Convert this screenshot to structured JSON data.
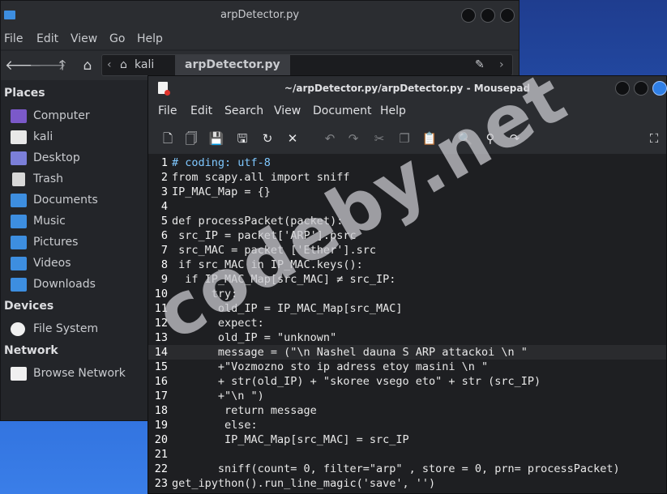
{
  "file_manager": {
    "title": "arpDetector.py",
    "menu": [
      "File",
      "Edit",
      "View",
      "Go",
      "Help"
    ],
    "breadcrumbs": [
      "kali",
      "arpDetector.py"
    ],
    "sidebar": {
      "places_header": "Places",
      "places": [
        "Computer",
        "kali",
        "Desktop",
        "Trash",
        "Documents",
        "Music",
        "Pictures",
        "Videos",
        "Downloads"
      ],
      "devices_header": "Devices",
      "devices": [
        "File System"
      ],
      "network_header": "Network",
      "network": [
        "Browse Network"
      ]
    }
  },
  "mousepad": {
    "title": "~/arpDetector.py/arpDetector.py - Mousepad",
    "menu": [
      "File",
      "Edit",
      "Search",
      "View",
      "Document",
      "Help"
    ],
    "toolbar_icons": [
      "new-icon",
      "new-window-icon",
      "save-icon",
      "save-as-icon",
      "reload-icon",
      "close-icon",
      "undo-icon",
      "redo-icon",
      "cut-icon",
      "copy-icon",
      "paste-icon",
      "find-icon",
      "find-replace-icon",
      "goto-icon",
      "fullscreen-icon"
    ],
    "current_line": 14,
    "lines": [
      {
        "n": "1",
        "text": "# coding: utf-8"
      },
      {
        "n": "2",
        "text": "from scapy.all import sniff"
      },
      {
        "n": "3",
        "text": "IP_MAC_Map = {}"
      },
      {
        "n": "4",
        "text": ""
      },
      {
        "n": "5",
        "text": "def processPacket(packet):"
      },
      {
        "n": "6",
        "text": " src_IP = packet['ARP'].psrc"
      },
      {
        "n": "7",
        "text": " src_MAC = packet ['Ether'].src"
      },
      {
        "n": "8",
        "text": " if src_MAC in IP_MAC.keys():"
      },
      {
        "n": "9",
        "text": "  if IP_MAC_Map[src_MAC] ≠ src_IP:"
      },
      {
        "n": "10",
        "text": "      try:"
      },
      {
        "n": "11",
        "text": "       old_IP = IP_MAC_Map[src_MAC]"
      },
      {
        "n": "12",
        "text": "       expect:"
      },
      {
        "n": "13",
        "text": "       old_IP = \"unknown\""
      },
      {
        "n": "14",
        "text": "       message = (\"\\n Nashel dauna S ARP attackoi \\n \""
      },
      {
        "n": "15",
        "text": "       +\"Vozmozno sto ip adress etoy masini \\n \""
      },
      {
        "n": "16",
        "text": "       + str(old_IP) + \"skoree vsego eto\" + str (src_IP)"
      },
      {
        "n": "17",
        "text": "       +\"\\n \")"
      },
      {
        "n": "18",
        "text": "        return message"
      },
      {
        "n": "19",
        "text": "        else:"
      },
      {
        "n": "20",
        "text": "        IP_MAC_Map[src_MAC] = src_IP"
      },
      {
        "n": "21",
        "text": ""
      },
      {
        "n": "22",
        "text": "       sniff(count= 0, filter=\"arp\" , store = 0, prn= processPacket)"
      },
      {
        "n": "23",
        "text": "get_ipython().run_line_magic('save', '')"
      }
    ]
  },
  "watermark": "codeby.net"
}
